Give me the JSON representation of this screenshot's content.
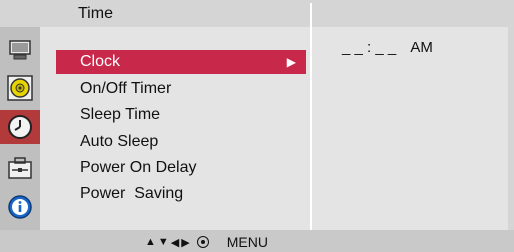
{
  "header": {
    "title": "Time"
  },
  "icons": [
    {
      "name": "picture-icon",
      "active": false
    },
    {
      "name": "audio-icon",
      "active": false
    },
    {
      "name": "time-icon",
      "active": true
    },
    {
      "name": "option-icon",
      "active": false
    },
    {
      "name": "information-icon",
      "active": false
    }
  ],
  "menu": {
    "items": [
      {
        "label": "Clock",
        "selected": true,
        "arrow": "▶"
      },
      {
        "label": "On/Off Timer",
        "selected": false
      },
      {
        "label": "Sleep Time",
        "selected": false
      },
      {
        "label": "Auto Sleep",
        "selected": false
      },
      {
        "label": "Power On Delay",
        "selected": false
      },
      {
        "label": "Power  Saving",
        "selected": false
      }
    ]
  },
  "value_panel": {
    "time": "_ _ : _ _",
    "ampm": "AM"
  },
  "footer": {
    "nav_up": "▲",
    "nav_down": "▼",
    "nav_left": "◀",
    "nav_right": "▶",
    "menu_label": "MENU"
  },
  "colors": {
    "selected_bg": "#c8284a",
    "active_icon_bg": "#b23a3a",
    "panel_bg": "#e4e4e4"
  }
}
